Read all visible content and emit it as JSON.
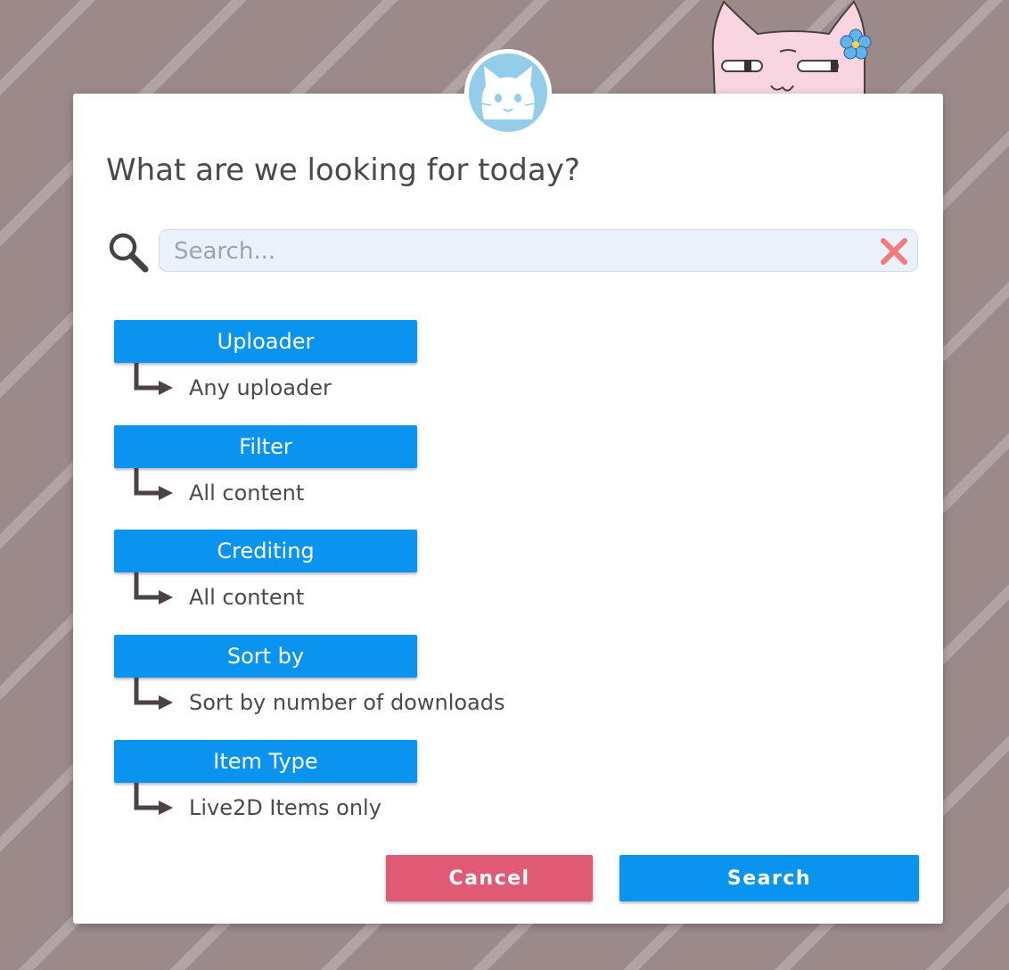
{
  "dialog": {
    "title": "What are we looking for today?"
  },
  "search": {
    "placeholder": "Search...",
    "value": ""
  },
  "options": [
    {
      "label": "Uploader",
      "value": "Any uploader"
    },
    {
      "label": "Filter",
      "value": "All content"
    },
    {
      "label": "Crediting",
      "value": "All content"
    },
    {
      "label": "Sort by",
      "value": "Sort by number of downloads"
    },
    {
      "label": "Item Type",
      "value": "Live2D Items only"
    }
  ],
  "actions": {
    "cancel_label": "Cancel",
    "search_label": "Search"
  },
  "icons": {
    "search": "magnifier-icon",
    "clear": "clear-x-icon",
    "avatar": "cat-avatar-icon",
    "option_arrow": "elbow-arrow-icon",
    "mascot": "pink-cat-mascot"
  },
  "colors": {
    "primary": "#0a94f0",
    "cancel": "#e05a75",
    "clear_icon": "#f27b7b",
    "avatar_bg": "#94cdea",
    "background": "#9c8a8b",
    "mascot": "#f8d5e0",
    "flower": "#5fb4ef"
  }
}
